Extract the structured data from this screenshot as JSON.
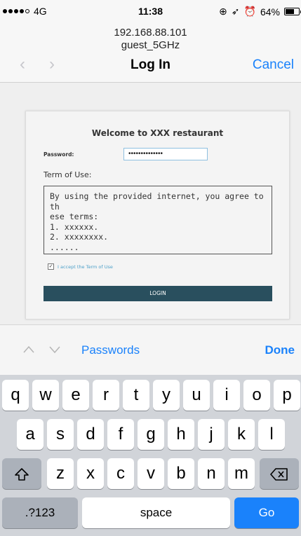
{
  "status_bar": {
    "carrier": "●●●●○ 4G",
    "signal": "4G",
    "time": "11:38",
    "battery": "64%",
    "battery_level": 0.64
  },
  "nav": {
    "host": "192.168.88.101",
    "ssid": "guest_5GHz",
    "title": "Log In",
    "cancel": "Cancel",
    "back_icon": "chevron-left-icon",
    "forward_icon": "chevron-right-icon"
  },
  "login_form": {
    "welcome": "Welcome to XXX restaurant",
    "password_label": "Password:",
    "password_value": "••••••••••••••",
    "term_label": "Term of Use:",
    "term_lines": [
      "By using the provided internet, you agree to th",
      "ese terms:",
      "1. xxxxxx.",
      "2. xxxxxxxx.",
      "......"
    ],
    "accept_label": "I accept the Term of Use",
    "accept_checked": true,
    "login_button": "LOGIN"
  },
  "accessory": {
    "passwords": "Passwords",
    "done": "Done"
  },
  "keyboard": {
    "row1": [
      "q",
      "w",
      "e",
      "r",
      "t",
      "y",
      "u",
      "i",
      "o",
      "p"
    ],
    "row2": [
      "a",
      "s",
      "d",
      "f",
      "g",
      "h",
      "j",
      "k",
      "l"
    ],
    "row3": [
      "z",
      "x",
      "c",
      "v",
      "b",
      "n",
      "m"
    ],
    "numbers": ".?123",
    "space": "space",
    "go": "Go"
  },
  "colors": {
    "accent": "#1a82fb",
    "login_button": "#294f5e",
    "keyboard_bg": "#d1d4d9"
  }
}
